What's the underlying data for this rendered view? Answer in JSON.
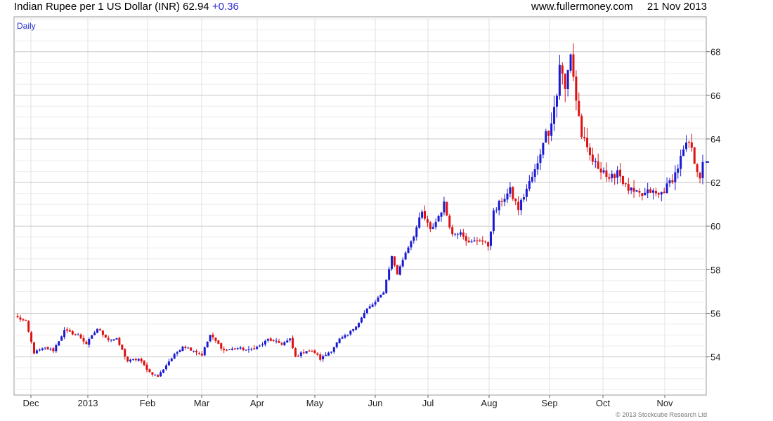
{
  "header": {
    "title": "Indian Rupee per 1 US Dollar (INR)",
    "last": "62.94",
    "change": "+0.36",
    "site": "www.fullermoney.com",
    "date": "21 Nov 2013"
  },
  "footer": {
    "copyright": "© 2013 Stockcube Research Ltd"
  },
  "chart_data": {
    "type": "candlestick",
    "label": "Daily",
    "ylim": [
      52.25,
      69.6
    ],
    "y_ticks": [
      54,
      56,
      58,
      60,
      62,
      64,
      66,
      68
    ],
    "x_labels": [
      "Dec",
      "2013",
      "Feb",
      "Mar",
      "Apr",
      "May",
      "Jun",
      "Jul",
      "Aug",
      "Sep",
      "Oct",
      "Nov"
    ],
    "grid": true,
    "up_color": "#1a1ad4",
    "down_color": "#dd1111",
    "last_value": 62.94,
    "anchors": [
      [
        0,
        55.8
      ],
      [
        3,
        55.6
      ],
      [
        6,
        54.2
      ],
      [
        10,
        54.4
      ],
      [
        13,
        54.3
      ],
      [
        17,
        55.2
      ],
      [
        22,
        55.0
      ],
      [
        25,
        54.6
      ],
      [
        29,
        55.3
      ],
      [
        33,
        54.8
      ],
      [
        36,
        54.8
      ],
      [
        40,
        53.8
      ],
      [
        44,
        53.9
      ],
      [
        48,
        53.3
      ],
      [
        51,
        53.1
      ],
      [
        55,
        53.8
      ],
      [
        60,
        54.5
      ],
      [
        64,
        54.3
      ],
      [
        67,
        54.1
      ],
      [
        70,
        55.0
      ],
      [
        75,
        54.3
      ],
      [
        80,
        54.4
      ],
      [
        84,
        54.3
      ],
      [
        88,
        54.5
      ],
      [
        91,
        54.8
      ],
      [
        96,
        54.6
      ],
      [
        99,
        54.8
      ],
      [
        101,
        54.0
      ],
      [
        105,
        54.3
      ],
      [
        108,
        54.2
      ],
      [
        110,
        53.9
      ],
      [
        114,
        54.3
      ],
      [
        117,
        54.8
      ],
      [
        120,
        55.0
      ],
      [
        124,
        55.6
      ],
      [
        127,
        56.2
      ],
      [
        130,
        56.5
      ],
      [
        133,
        57.0
      ],
      [
        136,
        58.6
      ],
      [
        138,
        57.8
      ],
      [
        141,
        58.8
      ],
      [
        144,
        59.6
      ],
      [
        147,
        60.6
      ],
      [
        150,
        59.8
      ],
      [
        152,
        60.2
      ],
      [
        155,
        61.0
      ],
      [
        158,
        59.6
      ],
      [
        161,
        59.8
      ],
      [
        164,
        59.2
      ],
      [
        168,
        59.4
      ],
      [
        171,
        59.1
      ],
      [
        173,
        60.6
      ],
      [
        176,
        61.2
      ],
      [
        179,
        61.6
      ],
      [
        182,
        60.8
      ],
      [
        185,
        61.7
      ],
      [
        189,
        62.8
      ],
      [
        191,
        64.0
      ],
      [
        193,
        64.4
      ],
      [
        196,
        66.0
      ],
      [
        197,
        67.5
      ],
      [
        199,
        66.2
      ],
      [
        201,
        68.0
      ],
      [
        203,
        65.8
      ],
      [
        205,
        64.2
      ],
      [
        207,
        63.4
      ],
      [
        210,
        62.8
      ],
      [
        213,
        62.6
      ],
      [
        215,
        62.0
      ],
      [
        218,
        62.6
      ],
      [
        221,
        61.8
      ],
      [
        224,
        61.5
      ],
      [
        227,
        61.4
      ],
      [
        230,
        61.6
      ],
      [
        233,
        61.4
      ],
      [
        236,
        61.8
      ],
      [
        239,
        62.4
      ],
      [
        242,
        63.4
      ],
      [
        244,
        63.8
      ],
      [
        246,
        63.0
      ],
      [
        248,
        62.3
      ],
      [
        249,
        62.94
      ]
    ]
  }
}
